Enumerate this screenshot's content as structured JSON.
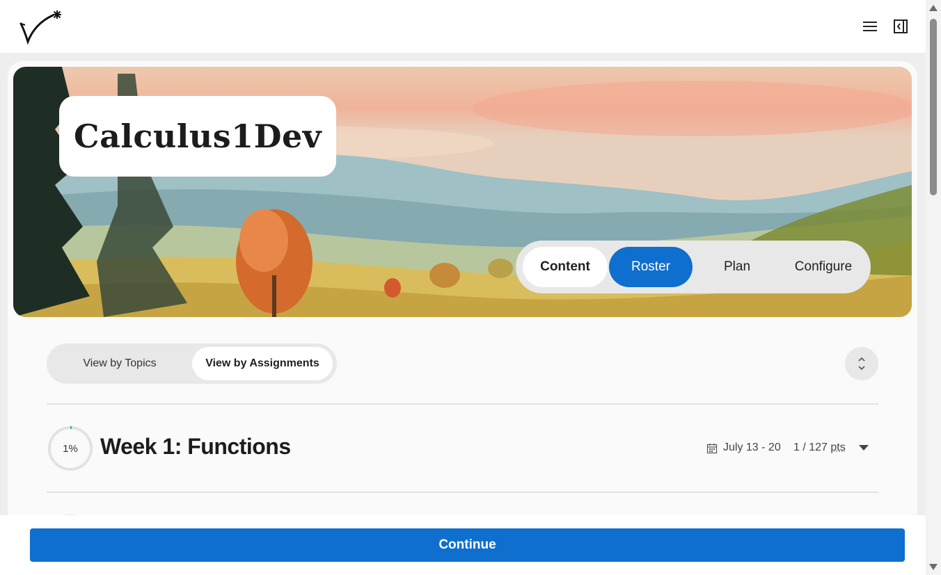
{
  "header": {
    "logo_icon": "checkmark-star-logo",
    "menu_icon": "hamburger-menu-icon",
    "panel_icon": "side-panel-toggle-icon"
  },
  "hero": {
    "course_title": "Calculus1Dev",
    "nav_tabs": [
      {
        "label": "Content",
        "state": "selected"
      },
      {
        "label": "Roster",
        "state": "highlighted"
      },
      {
        "label": "Plan",
        "state": "default"
      },
      {
        "label": "Configure",
        "state": "default"
      }
    ]
  },
  "view_toggle": {
    "options": [
      {
        "label": "View by Topics",
        "selected": false
      },
      {
        "label": "View by Assignments",
        "selected": true
      }
    ],
    "expand_icon": "expand-collapse-icon"
  },
  "weeks": [
    {
      "progress_label": "1%",
      "progress_value": 0.01,
      "title": "Week 1: Functions",
      "date_range": "July 13 - 20",
      "points_earned": "1 / 127",
      "points_unit": "pts"
    }
  ],
  "footer": {
    "continue_label": "Continue"
  },
  "colors": {
    "accent": "#0f6fcf",
    "progress": "#2aa198",
    "background": "#eeeeee"
  }
}
